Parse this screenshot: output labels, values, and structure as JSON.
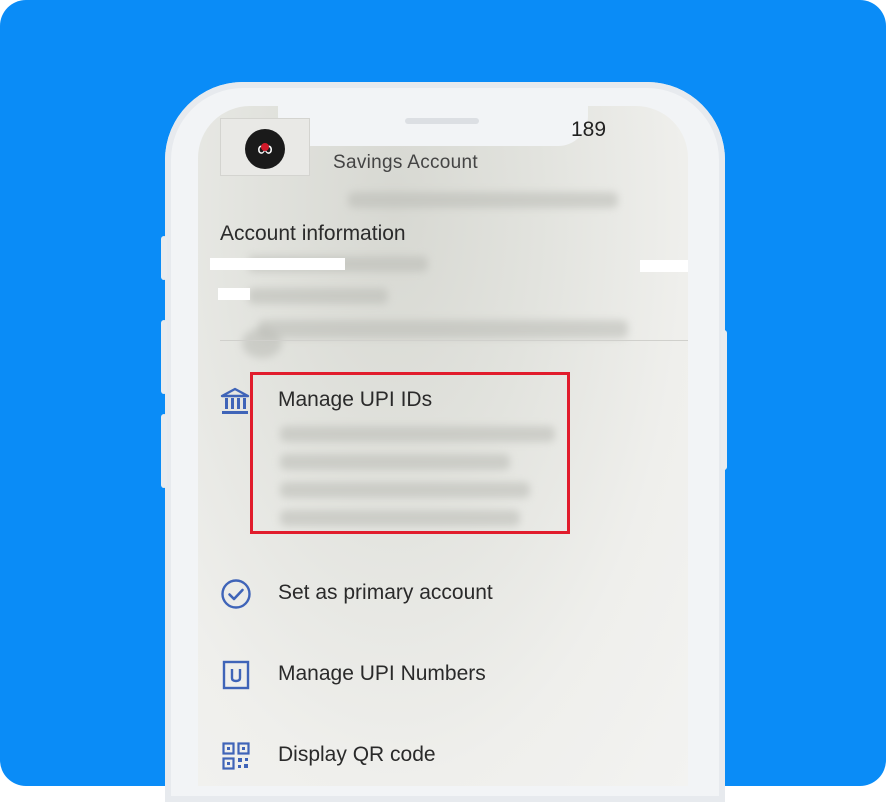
{
  "status": {
    "time": "189"
  },
  "header": {
    "logo_glyph": "∞",
    "account_type": "Savings Account"
  },
  "account": {
    "section_title": "Account information"
  },
  "menu": {
    "manage_upi_ids": "Manage UPI IDs",
    "set_primary": "Set as primary account",
    "manage_upi_numbers": "Manage UPI Numbers",
    "display_qr": "Display QR code"
  },
  "icons": {
    "bank": "bank-icon",
    "check": "check-circle-icon",
    "upi_number": "upi-number-icon",
    "qr": "qr-code-icon"
  },
  "colors": {
    "background": "#0a8cf7",
    "highlight": "#e11c2c",
    "icon": "#3f64b8"
  }
}
